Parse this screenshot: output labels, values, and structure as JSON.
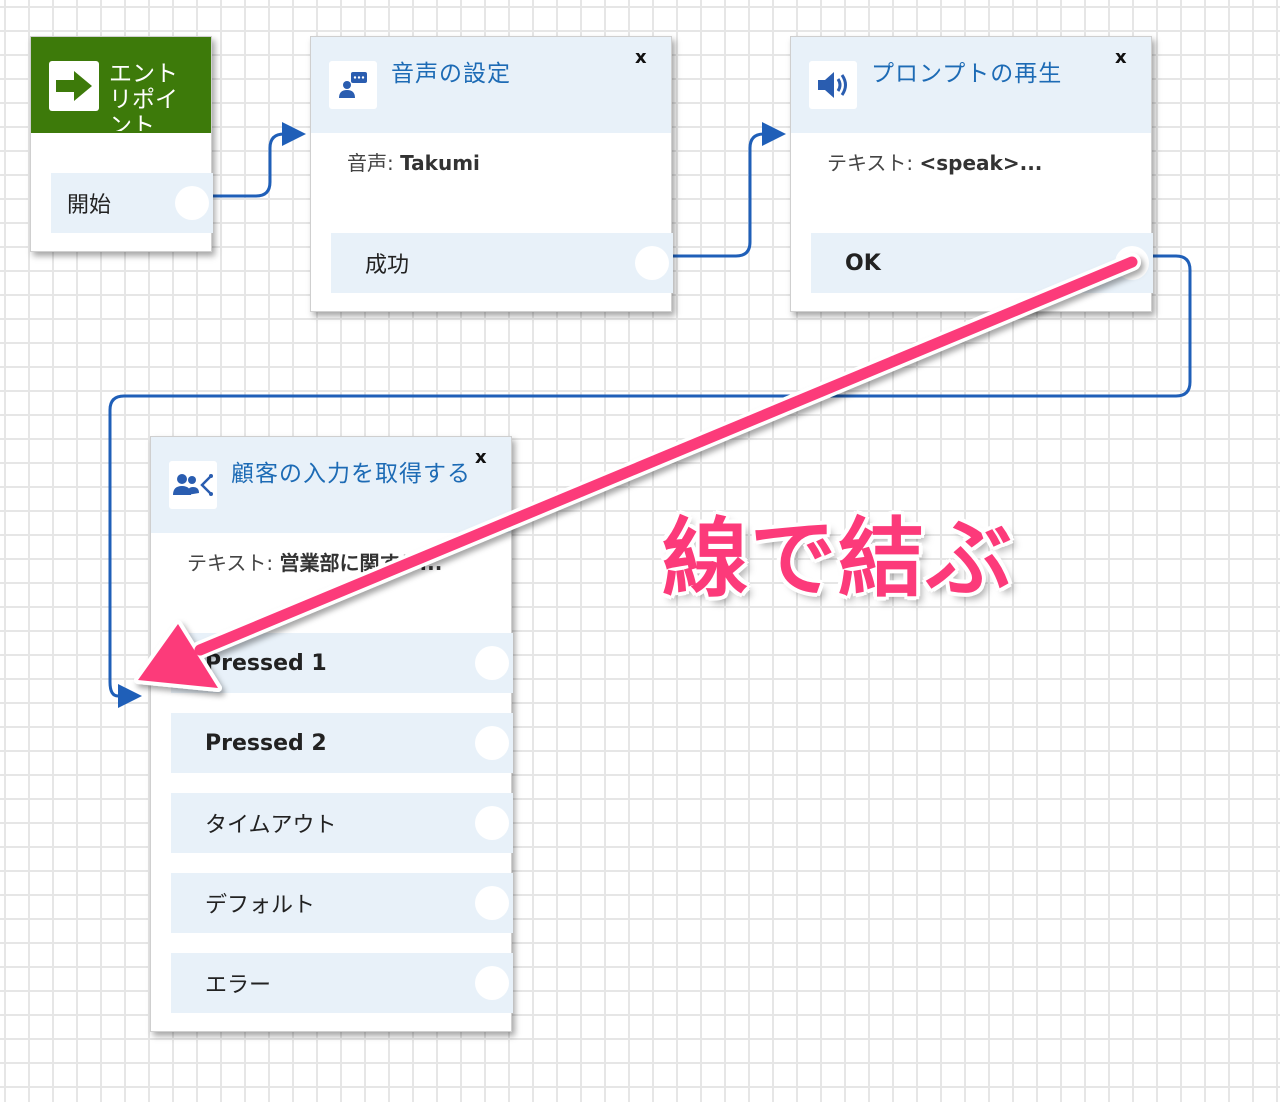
{
  "entry_block": {
    "title": "エントリポイント",
    "branch_label": "開始",
    "icon": "arrow-right-icon",
    "header_color": "#3d7a0a"
  },
  "voice_block": {
    "title": "音声の設定",
    "close_label": "x",
    "desc_label": "音声:",
    "desc_value": "Takumi",
    "branch_label": "成功",
    "icon": "voice-chat-icon"
  },
  "prompt_block": {
    "title": "プロンプトの再生",
    "close_label": "x",
    "desc_label": "テキスト:",
    "desc_value": "<speak>...",
    "branch_label": "OK",
    "icon": "speaker-icon"
  },
  "input_block": {
    "title": "顧客の入力を取得する",
    "close_label": "x",
    "desc_label": "テキスト:",
    "desc_value": "営業部に関する...",
    "icon": "user-branch-icon",
    "branches": [
      {
        "label": "Pressed 1"
      },
      {
        "label": "Pressed 2"
      },
      {
        "label": "タイムアウト"
      },
      {
        "label": "デフォルト"
      },
      {
        "label": "エラー"
      }
    ]
  },
  "annotation": {
    "text": "線で結ぶ",
    "color": "#fc3a7a"
  },
  "colors": {
    "connector": "#1f5fb8",
    "header_bg": "#e8f1f9",
    "title_text": "#1d6bb5"
  }
}
